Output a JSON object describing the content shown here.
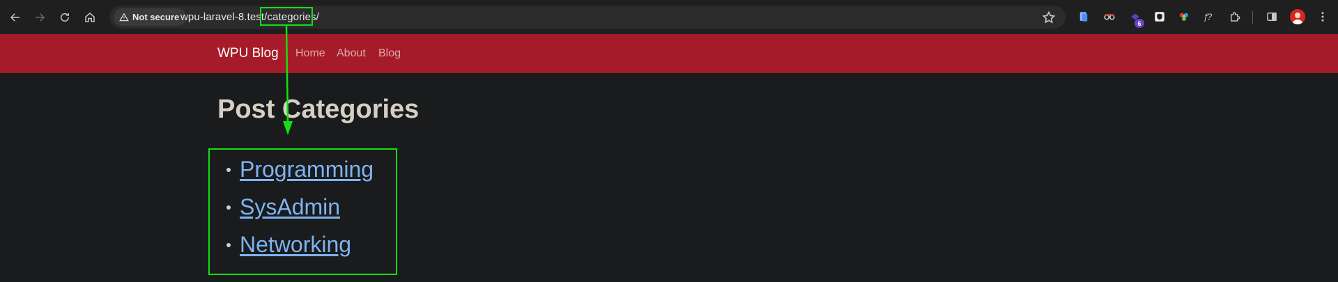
{
  "browser": {
    "security_label": "Not secure",
    "url_host": "wpu-laravel-8.test/",
    "url_path": "categories/",
    "extension_badge": "6"
  },
  "navbar": {
    "brand": "WPU Blog",
    "links": [
      "Home",
      "About",
      "Blog"
    ]
  },
  "page": {
    "title": "Post Categories",
    "categories": [
      "Programming",
      "SysAdmin",
      "Networking"
    ]
  },
  "colors": {
    "navbar": "#a61b29",
    "background": "#1a1b1d",
    "link": "#7fb3f0",
    "annotation": "#12e012"
  }
}
